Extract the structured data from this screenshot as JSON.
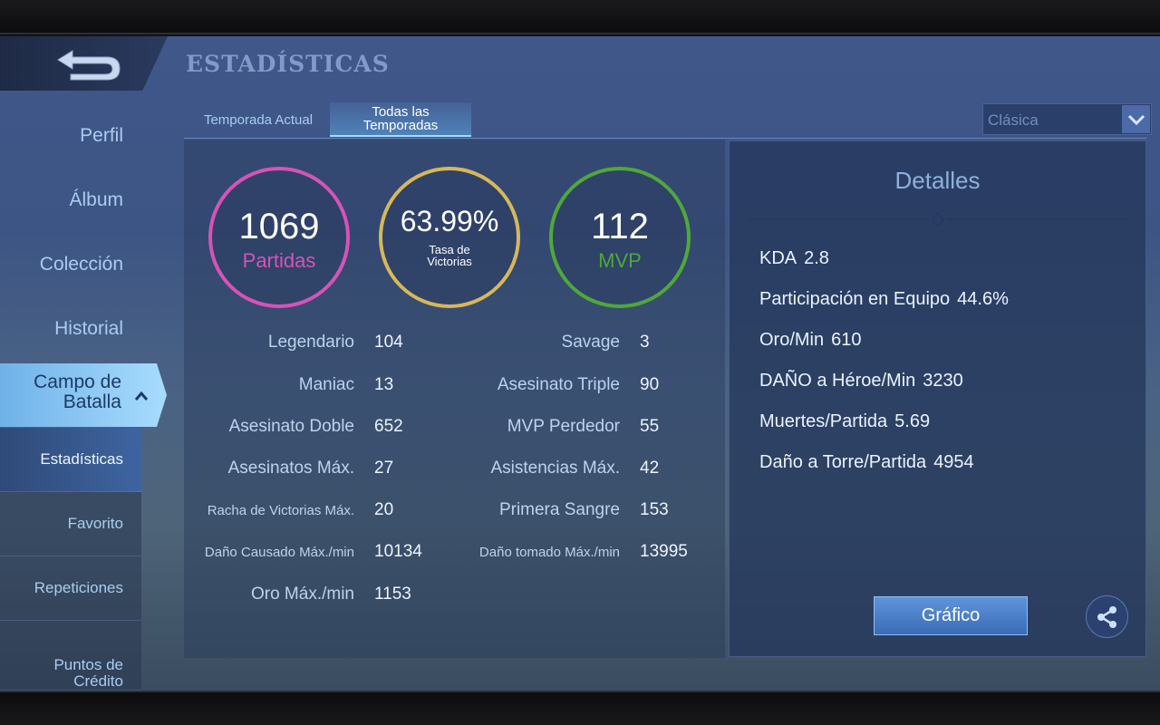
{
  "header": {
    "title": "ESTADÍSTICAS"
  },
  "sidebar": {
    "items": [
      {
        "label": "Perfil"
      },
      {
        "label": "Álbum"
      },
      {
        "label": "Colección"
      },
      {
        "label": "Historial"
      }
    ],
    "expanded": {
      "label_line1": "Campo de",
      "label_line2": "Batalla"
    },
    "subitems": [
      {
        "label": "Estadísticas"
      },
      {
        "label": "Favorito"
      },
      {
        "label": "Repeticiones"
      },
      {
        "label_line1": "Puntos de",
        "label_line2": "Crédito"
      }
    ]
  },
  "tabs": [
    {
      "label": "Temporada Actual"
    },
    {
      "label_line1": "Todas las",
      "label_line2": "Temporadas"
    }
  ],
  "mode_select": {
    "value": "Clásica"
  },
  "rings": [
    {
      "value": "1069",
      "label": "Partidas",
      "color": "#d653b8"
    },
    {
      "value": "63.99%",
      "label_line1": "Tasa de",
      "label_line2": "Victorias",
      "color": "#d6b85a"
    },
    {
      "value": "112",
      "label": "MVP",
      "color": "#4fa83a"
    }
  ],
  "stats_left": [
    {
      "label": "Legendario",
      "value": "104"
    },
    {
      "label": "Maniac",
      "value": "13"
    },
    {
      "label": "Asesinato Doble",
      "value": "652"
    },
    {
      "label": "Asesinatos Máx.",
      "value": "27"
    },
    {
      "label": "Racha de Victorias Máx.",
      "value": "20"
    },
    {
      "label": "Daño Causado Máx./min",
      "value": "10134"
    },
    {
      "label": "Oro Máx./min",
      "value": "1153"
    }
  ],
  "stats_right": [
    {
      "label": "Savage",
      "value": "3"
    },
    {
      "label": "Asesinato Triple",
      "value": "90"
    },
    {
      "label": "MVP Perdedor",
      "value": "55"
    },
    {
      "label": "Asistencias Máx.",
      "value": "42"
    },
    {
      "label": "Primera Sangre",
      "value": "153"
    },
    {
      "label": "Daño tomado Máx./min",
      "value": "13995"
    }
  ],
  "details": {
    "title": "Detalles",
    "rows": [
      {
        "label": "KDA",
        "value": "2.8"
      },
      {
        "label": "Participación en Equipo",
        "value": "44.6%"
      },
      {
        "label": "Oro/Min",
        "value": "610"
      },
      {
        "label": "DAÑO a Héroe/Min",
        "value": "3230"
      },
      {
        "label": "Muertes/Partida",
        "value": "5.69"
      },
      {
        "label": "Daño a Torre/Partida",
        "value": "4954"
      }
    ],
    "graph_button": "Gráfico"
  },
  "colors": {
    "accent": "#a9cdf0"
  }
}
